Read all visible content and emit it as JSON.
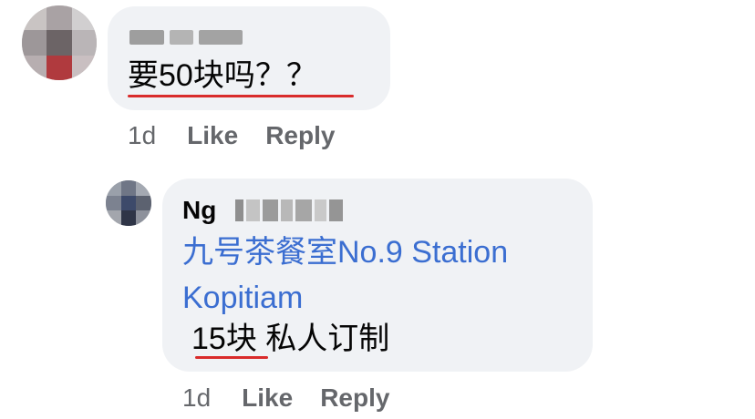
{
  "comments": [
    {
      "author": "",
      "text": "要50块吗？？",
      "time": "1d",
      "like_label": "Like",
      "reply_label": "Reply"
    },
    {
      "author": "Ng",
      "mention": "九号茶餐室No.9 Station Kopitiam",
      "text": "15块 私人订制",
      "time": "1d",
      "like_label": "Like",
      "reply_label": "Reply"
    }
  ],
  "colors": {
    "bubble": "#f0f2f5",
    "mention_link": "#3b6ed1",
    "secondary_text": "#65676b",
    "annotation_underline": "#d92b2b"
  }
}
